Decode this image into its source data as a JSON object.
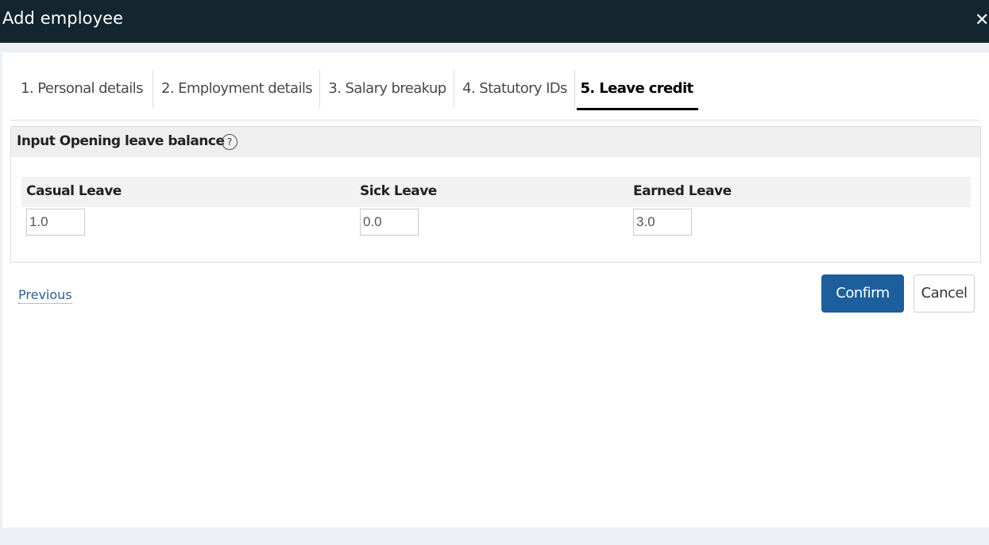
{
  "window": {
    "title": "Add employee",
    "close_icon": "close-icon"
  },
  "tabs": [
    {
      "label": "1. Personal details",
      "active": false
    },
    {
      "label": "2. Employment details",
      "active": false
    },
    {
      "label": "3. Salary breakup",
      "active": false
    },
    {
      "label": "4. Statutory IDs",
      "active": false
    },
    {
      "label": "5. Leave credit",
      "active": true
    }
  ],
  "section": {
    "title": "Input Opening leave balance",
    "help_icon": "?"
  },
  "leaves": [
    {
      "label": "Casual Leave",
      "value": "1.0"
    },
    {
      "label": "Sick Leave",
      "value": "0.0"
    },
    {
      "label": "Earned Leave",
      "value": "3.0"
    }
  ],
  "actions": {
    "previous": "Previous",
    "confirm": "Confirm",
    "cancel": "Cancel"
  },
  "colors": {
    "titlebar": "#13252e",
    "primary": "#1d5f9c",
    "link": "#2d6193"
  }
}
